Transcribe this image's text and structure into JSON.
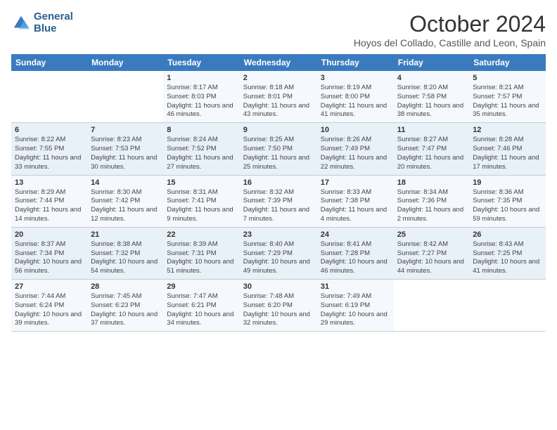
{
  "logo": {
    "line1": "General",
    "line2": "Blue"
  },
  "title": "October 2024",
  "subtitle": "Hoyos del Collado, Castille and Leon, Spain",
  "days_of_week": [
    "Sunday",
    "Monday",
    "Tuesday",
    "Wednesday",
    "Thursday",
    "Friday",
    "Saturday"
  ],
  "weeks": [
    [
      {
        "day": "",
        "info": ""
      },
      {
        "day": "",
        "info": ""
      },
      {
        "day": "1",
        "info": "Sunrise: 8:17 AM\nSunset: 8:03 PM\nDaylight: 11 hours and 46 minutes."
      },
      {
        "day": "2",
        "info": "Sunrise: 8:18 AM\nSunset: 8:01 PM\nDaylight: 11 hours and 43 minutes."
      },
      {
        "day": "3",
        "info": "Sunrise: 8:19 AM\nSunset: 8:00 PM\nDaylight: 11 hours and 41 minutes."
      },
      {
        "day": "4",
        "info": "Sunrise: 8:20 AM\nSunset: 7:58 PM\nDaylight: 11 hours and 38 minutes."
      },
      {
        "day": "5",
        "info": "Sunrise: 8:21 AM\nSunset: 7:57 PM\nDaylight: 11 hours and 35 minutes."
      }
    ],
    [
      {
        "day": "6",
        "info": "Sunrise: 8:22 AM\nSunset: 7:55 PM\nDaylight: 11 hours and 33 minutes."
      },
      {
        "day": "7",
        "info": "Sunrise: 8:23 AM\nSunset: 7:53 PM\nDaylight: 11 hours and 30 minutes."
      },
      {
        "day": "8",
        "info": "Sunrise: 8:24 AM\nSunset: 7:52 PM\nDaylight: 11 hours and 27 minutes."
      },
      {
        "day": "9",
        "info": "Sunrise: 8:25 AM\nSunset: 7:50 PM\nDaylight: 11 hours and 25 minutes."
      },
      {
        "day": "10",
        "info": "Sunrise: 8:26 AM\nSunset: 7:49 PM\nDaylight: 11 hours and 22 minutes."
      },
      {
        "day": "11",
        "info": "Sunrise: 8:27 AM\nSunset: 7:47 PM\nDaylight: 11 hours and 20 minutes."
      },
      {
        "day": "12",
        "info": "Sunrise: 8:28 AM\nSunset: 7:46 PM\nDaylight: 11 hours and 17 minutes."
      }
    ],
    [
      {
        "day": "13",
        "info": "Sunrise: 8:29 AM\nSunset: 7:44 PM\nDaylight: 11 hours and 14 minutes."
      },
      {
        "day": "14",
        "info": "Sunrise: 8:30 AM\nSunset: 7:42 PM\nDaylight: 11 hours and 12 minutes."
      },
      {
        "day": "15",
        "info": "Sunrise: 8:31 AM\nSunset: 7:41 PM\nDaylight: 11 hours and 9 minutes."
      },
      {
        "day": "16",
        "info": "Sunrise: 8:32 AM\nSunset: 7:39 PM\nDaylight: 11 hours and 7 minutes."
      },
      {
        "day": "17",
        "info": "Sunrise: 8:33 AM\nSunset: 7:38 PM\nDaylight: 11 hours and 4 minutes."
      },
      {
        "day": "18",
        "info": "Sunrise: 8:34 AM\nSunset: 7:36 PM\nDaylight: 11 hours and 2 minutes."
      },
      {
        "day": "19",
        "info": "Sunrise: 8:36 AM\nSunset: 7:35 PM\nDaylight: 10 hours and 59 minutes."
      }
    ],
    [
      {
        "day": "20",
        "info": "Sunrise: 8:37 AM\nSunset: 7:34 PM\nDaylight: 10 hours and 56 minutes."
      },
      {
        "day": "21",
        "info": "Sunrise: 8:38 AM\nSunset: 7:32 PM\nDaylight: 10 hours and 54 minutes."
      },
      {
        "day": "22",
        "info": "Sunrise: 8:39 AM\nSunset: 7:31 PM\nDaylight: 10 hours and 51 minutes."
      },
      {
        "day": "23",
        "info": "Sunrise: 8:40 AM\nSunset: 7:29 PM\nDaylight: 10 hours and 49 minutes."
      },
      {
        "day": "24",
        "info": "Sunrise: 8:41 AM\nSunset: 7:28 PM\nDaylight: 10 hours and 46 minutes."
      },
      {
        "day": "25",
        "info": "Sunrise: 8:42 AM\nSunset: 7:27 PM\nDaylight: 10 hours and 44 minutes."
      },
      {
        "day": "26",
        "info": "Sunrise: 8:43 AM\nSunset: 7:25 PM\nDaylight: 10 hours and 41 minutes."
      }
    ],
    [
      {
        "day": "27",
        "info": "Sunrise: 7:44 AM\nSunset: 6:24 PM\nDaylight: 10 hours and 39 minutes."
      },
      {
        "day": "28",
        "info": "Sunrise: 7:45 AM\nSunset: 6:23 PM\nDaylight: 10 hours and 37 minutes."
      },
      {
        "day": "29",
        "info": "Sunrise: 7:47 AM\nSunset: 6:21 PM\nDaylight: 10 hours and 34 minutes."
      },
      {
        "day": "30",
        "info": "Sunrise: 7:48 AM\nSunset: 6:20 PM\nDaylight: 10 hours and 32 minutes."
      },
      {
        "day": "31",
        "info": "Sunrise: 7:49 AM\nSunset: 6:19 PM\nDaylight: 10 hours and 29 minutes."
      },
      {
        "day": "",
        "info": ""
      },
      {
        "day": "",
        "info": ""
      }
    ]
  ]
}
